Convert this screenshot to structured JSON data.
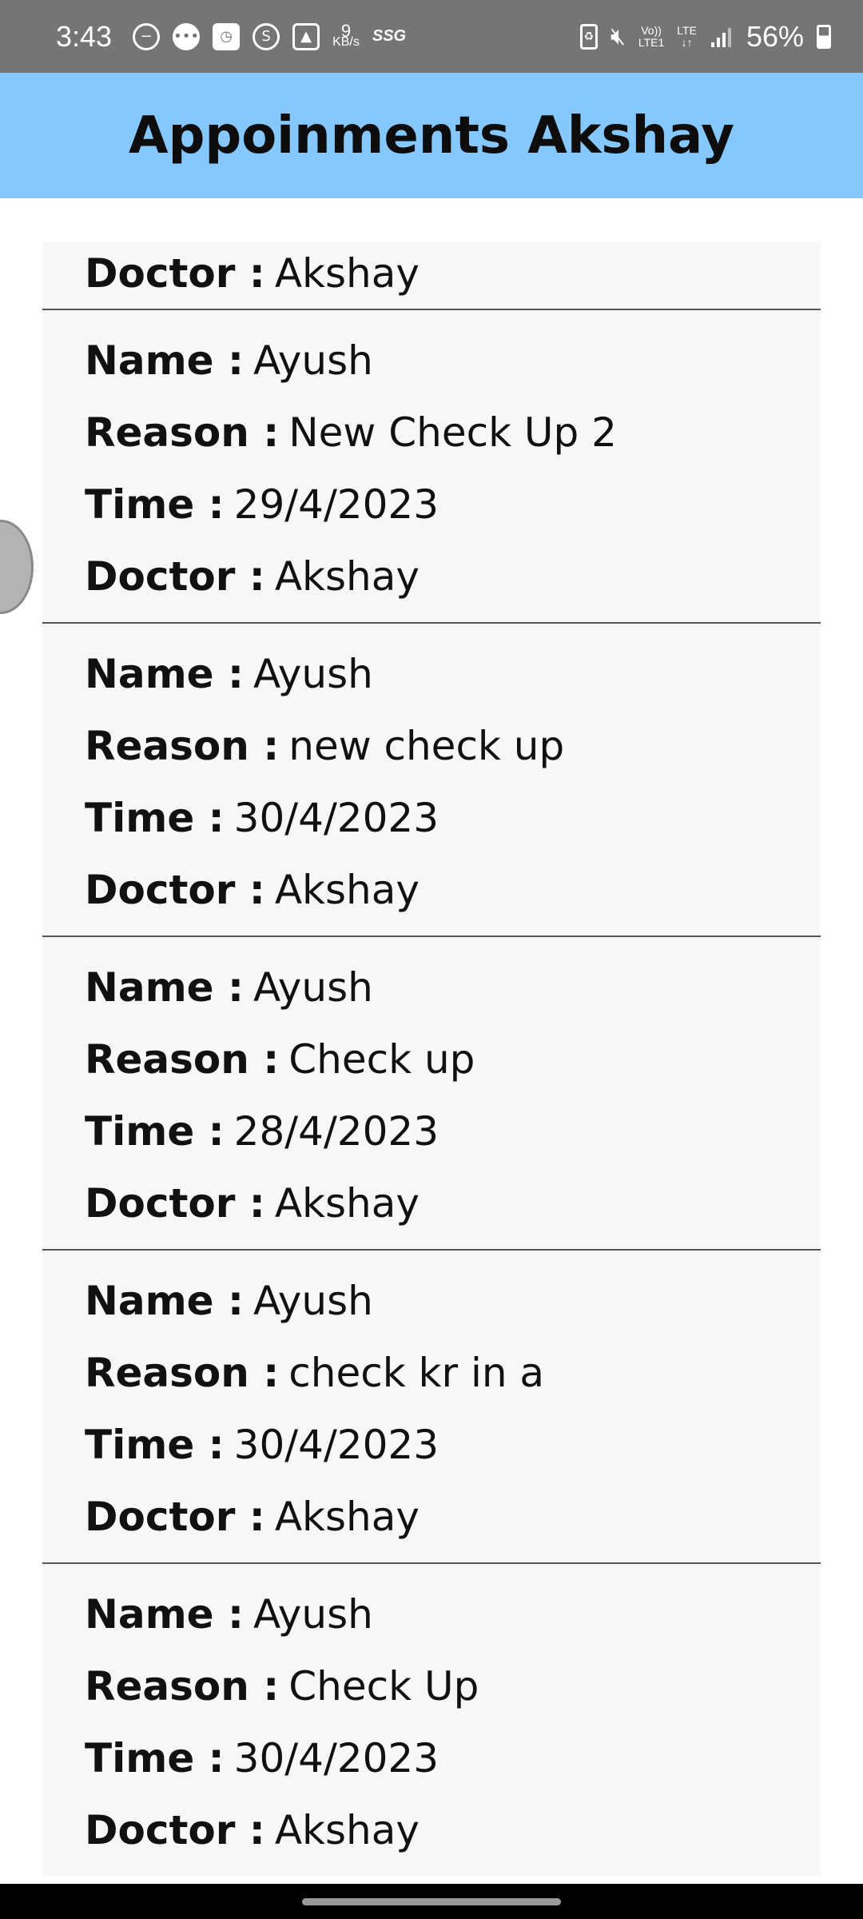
{
  "status_bar": {
    "time": "3:43",
    "net_speed_value": "9",
    "net_speed_unit": "KB/s",
    "carrier_tag": "SSG",
    "volte_top": "Vo))",
    "volte_bottom": "LTE1",
    "lte_top": "LTE",
    "lte_bottom": "↓↑",
    "battery": "56%"
  },
  "app_bar": {
    "title": "Appoinments Akshay"
  },
  "labels": {
    "name": "Name :",
    "reason": "Reason :",
    "time": "Time :",
    "doctor": "Doctor :"
  },
  "partial_card": {
    "doctor": "Akshay"
  },
  "appointments": [
    {
      "name": "Ayush",
      "reason": "New Check Up 2",
      "time": "29/4/2023",
      "doctor": "Akshay"
    },
    {
      "name": "Ayush",
      "reason": "new check up",
      "time": "30/4/2023",
      "doctor": "Akshay"
    },
    {
      "name": "Ayush",
      "reason": "Check up",
      "time": "28/4/2023",
      "doctor": "Akshay"
    },
    {
      "name": "Ayush",
      "reason": "check kr in a",
      "time": "30/4/2023",
      "doctor": "Akshay"
    },
    {
      "name": "Ayush",
      "reason": "Check Up",
      "time": "30/4/2023",
      "doctor": "Akshay"
    }
  ]
}
